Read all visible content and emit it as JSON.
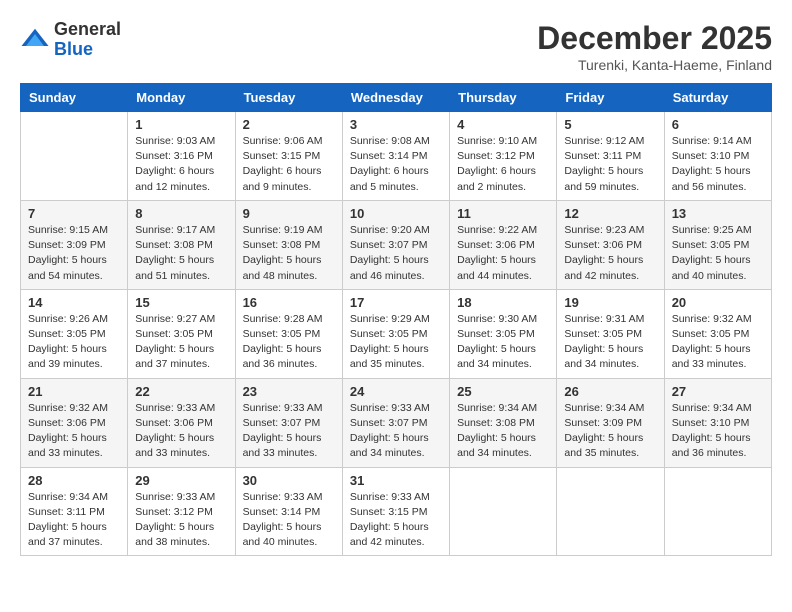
{
  "header": {
    "logo_general": "General",
    "logo_blue": "Blue",
    "title": "December 2025",
    "location": "Turenki, Kanta-Haeme, Finland"
  },
  "days_of_week": [
    "Sunday",
    "Monday",
    "Tuesday",
    "Wednesday",
    "Thursday",
    "Friday",
    "Saturday"
  ],
  "weeks": [
    [
      {
        "day": "",
        "info": ""
      },
      {
        "day": "1",
        "info": "Sunrise: 9:03 AM\nSunset: 3:16 PM\nDaylight: 6 hours\nand 12 minutes."
      },
      {
        "day": "2",
        "info": "Sunrise: 9:06 AM\nSunset: 3:15 PM\nDaylight: 6 hours\nand 9 minutes."
      },
      {
        "day": "3",
        "info": "Sunrise: 9:08 AM\nSunset: 3:14 PM\nDaylight: 6 hours\nand 5 minutes."
      },
      {
        "day": "4",
        "info": "Sunrise: 9:10 AM\nSunset: 3:12 PM\nDaylight: 6 hours\nand 2 minutes."
      },
      {
        "day": "5",
        "info": "Sunrise: 9:12 AM\nSunset: 3:11 PM\nDaylight: 5 hours\nand 59 minutes."
      },
      {
        "day": "6",
        "info": "Sunrise: 9:14 AM\nSunset: 3:10 PM\nDaylight: 5 hours\nand 56 minutes."
      }
    ],
    [
      {
        "day": "7",
        "info": "Sunrise: 9:15 AM\nSunset: 3:09 PM\nDaylight: 5 hours\nand 54 minutes."
      },
      {
        "day": "8",
        "info": "Sunrise: 9:17 AM\nSunset: 3:08 PM\nDaylight: 5 hours\nand 51 minutes."
      },
      {
        "day": "9",
        "info": "Sunrise: 9:19 AM\nSunset: 3:08 PM\nDaylight: 5 hours\nand 48 minutes."
      },
      {
        "day": "10",
        "info": "Sunrise: 9:20 AM\nSunset: 3:07 PM\nDaylight: 5 hours\nand 46 minutes."
      },
      {
        "day": "11",
        "info": "Sunrise: 9:22 AM\nSunset: 3:06 PM\nDaylight: 5 hours\nand 44 minutes."
      },
      {
        "day": "12",
        "info": "Sunrise: 9:23 AM\nSunset: 3:06 PM\nDaylight: 5 hours\nand 42 minutes."
      },
      {
        "day": "13",
        "info": "Sunrise: 9:25 AM\nSunset: 3:05 PM\nDaylight: 5 hours\nand 40 minutes."
      }
    ],
    [
      {
        "day": "14",
        "info": "Sunrise: 9:26 AM\nSunset: 3:05 PM\nDaylight: 5 hours\nand 39 minutes."
      },
      {
        "day": "15",
        "info": "Sunrise: 9:27 AM\nSunset: 3:05 PM\nDaylight: 5 hours\nand 37 minutes."
      },
      {
        "day": "16",
        "info": "Sunrise: 9:28 AM\nSunset: 3:05 PM\nDaylight: 5 hours\nand 36 minutes."
      },
      {
        "day": "17",
        "info": "Sunrise: 9:29 AM\nSunset: 3:05 PM\nDaylight: 5 hours\nand 35 minutes."
      },
      {
        "day": "18",
        "info": "Sunrise: 9:30 AM\nSunset: 3:05 PM\nDaylight: 5 hours\nand 34 minutes."
      },
      {
        "day": "19",
        "info": "Sunrise: 9:31 AM\nSunset: 3:05 PM\nDaylight: 5 hours\nand 34 minutes."
      },
      {
        "day": "20",
        "info": "Sunrise: 9:32 AM\nSunset: 3:05 PM\nDaylight: 5 hours\nand 33 minutes."
      }
    ],
    [
      {
        "day": "21",
        "info": "Sunrise: 9:32 AM\nSunset: 3:06 PM\nDaylight: 5 hours\nand 33 minutes."
      },
      {
        "day": "22",
        "info": "Sunrise: 9:33 AM\nSunset: 3:06 PM\nDaylight: 5 hours\nand 33 minutes."
      },
      {
        "day": "23",
        "info": "Sunrise: 9:33 AM\nSunset: 3:07 PM\nDaylight: 5 hours\nand 33 minutes."
      },
      {
        "day": "24",
        "info": "Sunrise: 9:33 AM\nSunset: 3:07 PM\nDaylight: 5 hours\nand 34 minutes."
      },
      {
        "day": "25",
        "info": "Sunrise: 9:34 AM\nSunset: 3:08 PM\nDaylight: 5 hours\nand 34 minutes."
      },
      {
        "day": "26",
        "info": "Sunrise: 9:34 AM\nSunset: 3:09 PM\nDaylight: 5 hours\nand 35 minutes."
      },
      {
        "day": "27",
        "info": "Sunrise: 9:34 AM\nSunset: 3:10 PM\nDaylight: 5 hours\nand 36 minutes."
      }
    ],
    [
      {
        "day": "28",
        "info": "Sunrise: 9:34 AM\nSunset: 3:11 PM\nDaylight: 5 hours\nand 37 minutes."
      },
      {
        "day": "29",
        "info": "Sunrise: 9:33 AM\nSunset: 3:12 PM\nDaylight: 5 hours\nand 38 minutes."
      },
      {
        "day": "30",
        "info": "Sunrise: 9:33 AM\nSunset: 3:14 PM\nDaylight: 5 hours\nand 40 minutes."
      },
      {
        "day": "31",
        "info": "Sunrise: 9:33 AM\nSunset: 3:15 PM\nDaylight: 5 hours\nand 42 minutes."
      },
      {
        "day": "",
        "info": ""
      },
      {
        "day": "",
        "info": ""
      },
      {
        "day": "",
        "info": ""
      }
    ]
  ]
}
